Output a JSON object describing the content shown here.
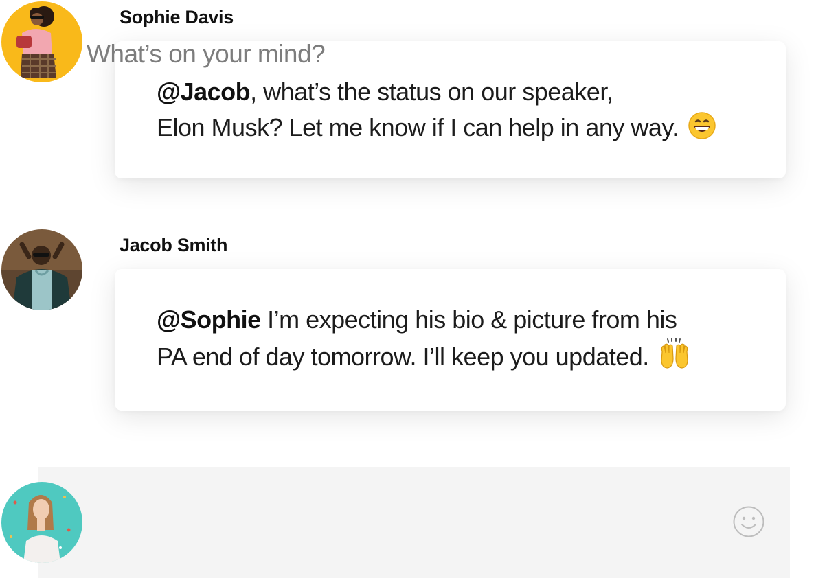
{
  "messages": [
    {
      "author": "Sophie Davis",
      "avatar_icon": "avatar-sophie-icon",
      "mention": "@Jacob",
      "text_line1_after_mention": ", what’s the status on our speaker,",
      "text_line2": "Elon Musk? Let me know if I can help in any way.",
      "emoji": "grinning-face-icon"
    },
    {
      "author": "Jacob Smith",
      "avatar_icon": "avatar-jacob-icon",
      "mention": "@Sophie",
      "text_line1_after_mention": " I’m expecting his bio & picture from his",
      "text_line2": "PA end of day tomorrow. I’ll keep you updated.",
      "emoji": "raising-hands-icon"
    }
  ],
  "composer": {
    "placeholder": "What’s on your mind?",
    "avatar_icon": "avatar-current-user-icon",
    "emoji_button_icon": "smiley-icon"
  },
  "colors": {
    "composer_bg": "#f4f4f4",
    "sophie_avatar_bg": "#f9b91a",
    "jacob_avatar_bg": "#7a5a3c",
    "user_avatar_bg": "#4fc9c0"
  }
}
